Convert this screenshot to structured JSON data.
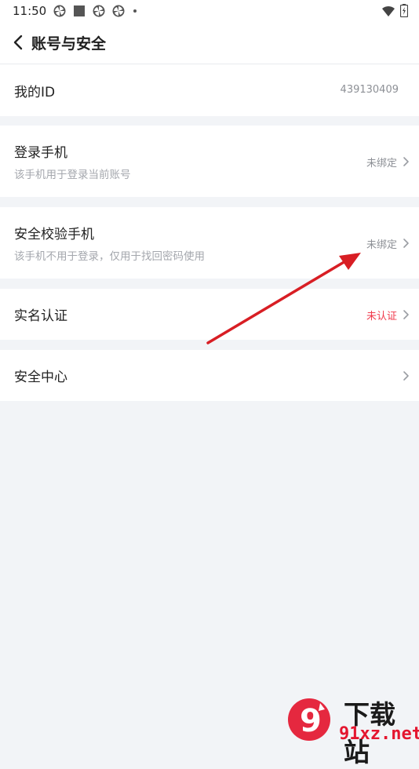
{
  "status_bar": {
    "time": "11:50",
    "icons": [
      "pinwheel-icon",
      "square-icon",
      "pinwheel-icon",
      "pinwheel-icon",
      "dot-icon"
    ],
    "right_icons": [
      "wifi-icon",
      "battery-icon"
    ]
  },
  "header": {
    "title": "账号与安全",
    "back_icon": "chevron-left-icon"
  },
  "rows": [
    {
      "title": "我的ID",
      "value": "439130409"
    },
    {
      "title": "登录手机",
      "subtitle": "该手机用于登录当前账号",
      "value": "未绑定"
    },
    {
      "title": "安全校验手机",
      "subtitle": "该手机不用于登录，仅用于找回密码使用",
      "value": "未绑定"
    },
    {
      "title": "实名认证",
      "value": "未认证",
      "value_color": "#f03a4c"
    },
    {
      "title": "安全中心"
    }
  ],
  "watermark": {
    "brand": "下载站",
    "url": "91xz.net",
    "logo_text": "9"
  },
  "colors": {
    "background": "#f2f4f7",
    "card": "#ffffff",
    "alert_red": "#f03a4c",
    "annotation_arrow": "#d81e24"
  }
}
